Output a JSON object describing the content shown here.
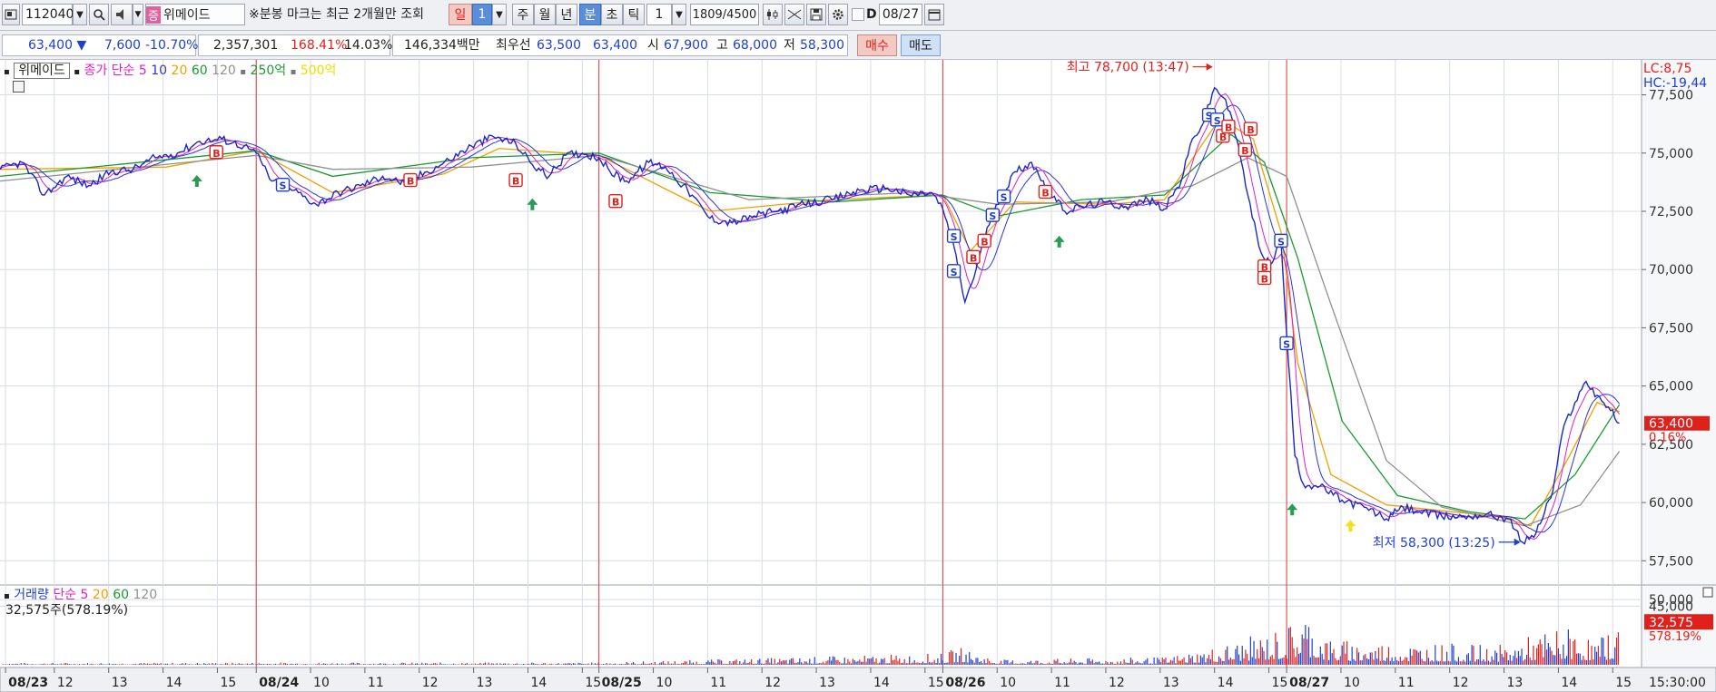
{
  "toolbar": {
    "code": "112040",
    "stock_name_tag": "증",
    "stock_name": "위메이드",
    "notice": "※분봉 마크는 최근 2개월만 조회",
    "periods": [
      "일",
      "1",
      "주",
      "월",
      "년",
      "분",
      "초",
      "틱"
    ],
    "interval": "1",
    "count": "1809/4500",
    "d_label": "D",
    "date": "08/27"
  },
  "quote": {
    "price": "63,400",
    "change": "7,600",
    "change_pct": "-10.70%",
    "volume": "2,357,301",
    "vol_ratio": "168.41%",
    "turnover": "14.03%",
    "amount": "146,334백만",
    "best_label": "최우선",
    "best_ask": "63,500",
    "best_bid": "63,400",
    "open_label": "시",
    "open": "67,900",
    "high_label": "고",
    "high": "68,000",
    "low_label": "저",
    "low": "58,300",
    "buy": "매수",
    "sell": "매도"
  },
  "colors": {
    "price": "#1b27c8",
    "ma5": "#e020c0",
    "ma10": "#2c33d8",
    "ma20": "#f0a000",
    "ma60": "#1a9a2c",
    "ma120": "#909090",
    "up": "#e0201b",
    "down": "#1f3fd0",
    "grid": "#d8dce6",
    "day_sep": "#e03a3a",
    "buy_mark": "#e0201b",
    "sell_mark": "#1f3fd0",
    "arrow": "#1a9a5a"
  },
  "chart_data": {
    "type": "line",
    "title": "위메이드",
    "price_legend": {
      "name": "위메이드",
      "series_label": "종가 단순",
      "periods": [
        "5",
        "10",
        "20",
        "60",
        "120"
      ],
      "extra": [
        "250억",
        "500억"
      ]
    },
    "volume_legend": {
      "name": "거래량",
      "series_label": "단순",
      "periods": [
        "5",
        "20",
        "60",
        "120"
      ],
      "current": "32,575주(578.19%)"
    },
    "x_tick_labels": [
      {
        "t": 0.1,
        "label": "08/23",
        "bold": true
      },
      {
        "t": 0.98,
        "label": "12"
      },
      {
        "t": 1.96,
        "label": "13"
      },
      {
        "t": 2.94,
        "label": "14"
      },
      {
        "t": 3.92,
        "label": "15"
      },
      {
        "t": 4.62,
        "label": "08/24",
        "bold": true
      },
      {
        "t": 5.6,
        "label": "10"
      },
      {
        "t": 6.58,
        "label": "11"
      },
      {
        "t": 7.56,
        "label": "12"
      },
      {
        "t": 8.54,
        "label": "13"
      },
      {
        "t": 9.52,
        "label": "14"
      },
      {
        "t": 10.5,
        "label": "15"
      },
      {
        "t": 10.8,
        "label": "08/25",
        "bold": true
      },
      {
        "t": 11.78,
        "label": "10"
      },
      {
        "t": 12.76,
        "label": "11"
      },
      {
        "t": 13.74,
        "label": "12"
      },
      {
        "t": 14.72,
        "label": "13"
      },
      {
        "t": 15.7,
        "label": "14"
      },
      {
        "t": 16.68,
        "label": "15"
      },
      {
        "t": 17.0,
        "label": "08/26",
        "bold": true
      },
      {
        "t": 17.98,
        "label": "10"
      },
      {
        "t": 18.96,
        "label": "11"
      },
      {
        "t": 19.94,
        "label": "12"
      },
      {
        "t": 20.92,
        "label": "13"
      },
      {
        "t": 21.9,
        "label": "14"
      },
      {
        "t": 22.88,
        "label": "15"
      },
      {
        "t": 23.2,
        "label": "08/27",
        "bold": true
      },
      {
        "t": 24.18,
        "label": "10"
      },
      {
        "t": 25.16,
        "label": "11"
      },
      {
        "t": 26.14,
        "label": "12"
      },
      {
        "t": 27.12,
        "label": "13"
      },
      {
        "t": 28.1,
        "label": "14"
      },
      {
        "t": 29.08,
        "label": "15"
      }
    ],
    "day_separators": [
      4.62,
      10.8,
      17.0,
      23.2
    ],
    "ylim": [
      56500,
      79000
    ],
    "y_ticks": [
      57500,
      60000,
      62500,
      65000,
      67500,
      70000,
      72500,
      75000,
      77500
    ],
    "y_tick_labels": [
      "57,500",
      "60,000",
      "62,500",
      "65,000",
      "67,500",
      "70,000",
      "72,500",
      "75,000",
      "77,500"
    ],
    "price_path": [
      [
        0,
        74300
      ],
      [
        0.4,
        74600
      ],
      [
        0.8,
        73200
      ],
      [
        1.2,
        74000
      ],
      [
        1.6,
        73600
      ],
      [
        2.0,
        74200
      ],
      [
        2.4,
        74300
      ],
      [
        2.8,
        74800
      ],
      [
        3.2,
        75000
      ],
      [
        3.6,
        75500
      ],
      [
        4.0,
        75600
      ],
      [
        4.4,
        75300
      ],
      [
        4.62,
        75000
      ],
      [
        4.9,
        73800
      ],
      [
        5.3,
        73400
      ],
      [
        5.7,
        72800
      ],
      [
        6.1,
        73300
      ],
      [
        6.5,
        73600
      ],
      [
        6.9,
        74000
      ],
      [
        7.3,
        73700
      ],
      [
        7.7,
        74200
      ],
      [
        8.1,
        74700
      ],
      [
        8.5,
        75300
      ],
      [
        8.9,
        75700
      ],
      [
        9.3,
        75400
      ],
      [
        9.6,
        74500
      ],
      [
        9.9,
        74000
      ],
      [
        10.2,
        74900
      ],
      [
        10.5,
        75000
      ],
      [
        10.8,
        74800
      ],
      [
        11.0,
        74200
      ],
      [
        11.3,
        73800
      ],
      [
        11.7,
        74600
      ],
      [
        12.0,
        74400
      ],
      [
        12.4,
        73400
      ],
      [
        12.8,
        72200
      ],
      [
        13.2,
        72000
      ],
      [
        13.6,
        72300
      ],
      [
        14.0,
        72500
      ],
      [
        14.5,
        72800
      ],
      [
        15.0,
        73000
      ],
      [
        15.5,
        73400
      ],
      [
        16.0,
        73500
      ],
      [
        16.4,
        73200
      ],
      [
        16.8,
        73300
      ],
      [
        17.0,
        72600
      ],
      [
        17.2,
        71000
      ],
      [
        17.4,
        68600
      ],
      [
        17.6,
        70000
      ],
      [
        17.8,
        71800
      ],
      [
        18.0,
        72800
      ],
      [
        18.3,
        74200
      ],
      [
        18.6,
        74600
      ],
      [
        18.9,
        73400
      ],
      [
        19.2,
        72500
      ],
      [
        19.5,
        72700
      ],
      [
        19.9,
        72900
      ],
      [
        20.3,
        72700
      ],
      [
        20.7,
        73000
      ],
      [
        21.0,
        72600
      ],
      [
        21.3,
        73800
      ],
      [
        21.5,
        75600
      ],
      [
        21.7,
        76300
      ],
      [
        21.9,
        77800
      ],
      [
        22.1,
        77300
      ],
      [
        22.3,
        75600
      ],
      [
        22.5,
        73200
      ],
      [
        22.7,
        71000
      ],
      [
        22.9,
        70200
      ],
      [
        23.1,
        71200
      ],
      [
        23.2,
        67200
      ],
      [
        23.35,
        62000
      ],
      [
        23.5,
        60800
      ],
      [
        23.8,
        60700
      ],
      [
        24.2,
        60100
      ],
      [
        24.6,
        59800
      ],
      [
        25.0,
        59300
      ],
      [
        25.3,
        59800
      ],
      [
        25.6,
        59600
      ],
      [
        26.0,
        59400
      ],
      [
        26.4,
        59400
      ],
      [
        26.8,
        59500
      ],
      [
        27.2,
        59300
      ],
      [
        27.45,
        58300
      ],
      [
        27.7,
        58700
      ],
      [
        28.0,
        60500
      ],
      [
        28.2,
        63300
      ],
      [
        28.4,
        64300
      ],
      [
        28.6,
        65200
      ],
      [
        28.8,
        64600
      ],
      [
        29.0,
        64100
      ],
      [
        29.2,
        63400
      ]
    ],
    "ma_paths": {
      "ma20": [
        [
          0,
          74300
        ],
        [
          3,
          74400
        ],
        [
          4.62,
          75100
        ],
        [
          6,
          73300
        ],
        [
          8,
          74100
        ],
        [
          9,
          75200
        ],
        [
          10.8,
          74900
        ],
        [
          12.8,
          72500
        ],
        [
          15,
          73000
        ],
        [
          17,
          73200
        ],
        [
          17.5,
          70800
        ],
        [
          18.3,
          72900
        ],
        [
          20,
          72800
        ],
        [
          21,
          73000
        ],
        [
          22,
          76500
        ],
        [
          22.6,
          75600
        ],
        [
          23.1,
          71600
        ],
        [
          23.4,
          66000
        ],
        [
          24,
          61200
        ],
        [
          25,
          59900
        ],
        [
          27,
          59400
        ],
        [
          27.6,
          59000
        ],
        [
          28.3,
          62000
        ],
        [
          28.8,
          64300
        ],
        [
          29.2,
          63900
        ]
      ],
      "ma60": [
        [
          0,
          74000
        ],
        [
          4.62,
          75100
        ],
        [
          6,
          74000
        ],
        [
          8.5,
          74800
        ],
        [
          10.8,
          75000
        ],
        [
          12.8,
          73300
        ],
        [
          15,
          72900
        ],
        [
          17,
          73200
        ],
        [
          18,
          72300
        ],
        [
          19.5,
          73000
        ],
        [
          21,
          73200
        ],
        [
          22.2,
          75800
        ],
        [
          22.8,
          74600
        ],
        [
          23.4,
          70500
        ],
        [
          24.2,
          63500
        ],
        [
          25.2,
          60300
        ],
        [
          26.5,
          59600
        ],
        [
          27.5,
          59300
        ],
        [
          28.4,
          61200
        ],
        [
          29.2,
          64200
        ]
      ],
      "ma120": [
        [
          0,
          73800
        ],
        [
          4.62,
          74900
        ],
        [
          6,
          74300
        ],
        [
          8.5,
          74400
        ],
        [
          10.8,
          74900
        ],
        [
          13.5,
          73000
        ],
        [
          16.5,
          73300
        ],
        [
          18,
          72800
        ],
        [
          20,
          72900
        ],
        [
          21.5,
          73600
        ],
        [
          22.5,
          74800
        ],
        [
          23.2,
          74000
        ],
        [
          24.0,
          68500
        ],
        [
          25.0,
          61800
        ],
        [
          26.0,
          59800
        ],
        [
          27.5,
          59000
        ],
        [
          28.5,
          59900
        ],
        [
          29.2,
          62200
        ]
      ]
    },
    "annotations": {
      "high": {
        "t": 21.9,
        "value": 78700,
        "label": "최고 78,700 (13:47)"
      },
      "low": {
        "t": 27.45,
        "value": 58300,
        "label": "최저 58,300 (13:25)"
      },
      "current": {
        "value": 63400,
        "label": "63,400",
        "pct": "0.16%"
      },
      "lc": "LC:8,75",
      "hc": "HC:-19,44",
      "time": "15:30:00"
    },
    "marks": [
      {
        "t": 3.9,
        "value": 75000,
        "type": "B"
      },
      {
        "t": 5.1,
        "value": 73600,
        "type": "S"
      },
      {
        "t": 7.4,
        "value": 73800,
        "type": "B"
      },
      {
        "t": 9.3,
        "value": 73800,
        "type": "B"
      },
      {
        "t": 11.1,
        "value": 72900,
        "type": "B"
      },
      {
        "t": 17.2,
        "value": 71400,
        "type": "S"
      },
      {
        "t": 17.2,
        "value": 69900,
        "type": "S"
      },
      {
        "t": 17.55,
        "value": 70500,
        "type": "B"
      },
      {
        "t": 17.75,
        "value": 71200,
        "type": "B"
      },
      {
        "t": 17.9,
        "value": 72300,
        "type": "S"
      },
      {
        "t": 18.1,
        "value": 73100,
        "type": "S"
      },
      {
        "t": 18.85,
        "value": 73300,
        "type": "B"
      },
      {
        "t": 21.8,
        "value": 76600,
        "type": "S"
      },
      {
        "t": 21.95,
        "value": 76400,
        "type": "S"
      },
      {
        "t": 22.05,
        "value": 75700,
        "type": "B"
      },
      {
        "t": 22.15,
        "value": 76100,
        "type": "B"
      },
      {
        "t": 22.45,
        "value": 75100,
        "type": "B"
      },
      {
        "t": 22.55,
        "value": 76000,
        "type": "B"
      },
      {
        "t": 22.8,
        "value": 70100,
        "type": "B"
      },
      {
        "t": 22.8,
        "value": 69600,
        "type": "B"
      },
      {
        "t": 23.1,
        "value": 71200,
        "type": "S"
      },
      {
        "t": 23.2,
        "value": 66800,
        "type": "S"
      }
    ],
    "arrows": [
      {
        "t": 3.55,
        "value": 74600,
        "color": "green"
      },
      {
        "t": 9.6,
        "value": 73600,
        "color": "green"
      },
      {
        "t": 19.1,
        "value": 72000,
        "color": "green"
      },
      {
        "t": 23.3,
        "value": 60500,
        "color": "green"
      },
      {
        "t": 24.35,
        "value": 59800,
        "color": "yellow"
      }
    ],
    "volume": {
      "ylim": [
        0,
        55000
      ],
      "y_ticks": [
        45000,
        50000
      ],
      "y_tick_labels": [
        "45,000",
        "50,000"
      ],
      "current": "32,575",
      "current_pct": "578.19%",
      "bars_summary": [
        [
          0,
          1500
        ],
        [
          4.62,
          1800
        ],
        [
          10.8,
          1800
        ],
        [
          17.0,
          9000
        ],
        [
          17.3,
          14000
        ],
        [
          18,
          4000
        ],
        [
          21,
          6000
        ],
        [
          22,
          15000
        ],
        [
          23.2,
          30000
        ],
        [
          23.5,
          45000
        ],
        [
          24,
          20000
        ],
        [
          27,
          15000
        ],
        [
          28.2,
          30000
        ],
        [
          28.8,
          20000
        ],
        [
          29.2,
          32575
        ]
      ]
    }
  }
}
